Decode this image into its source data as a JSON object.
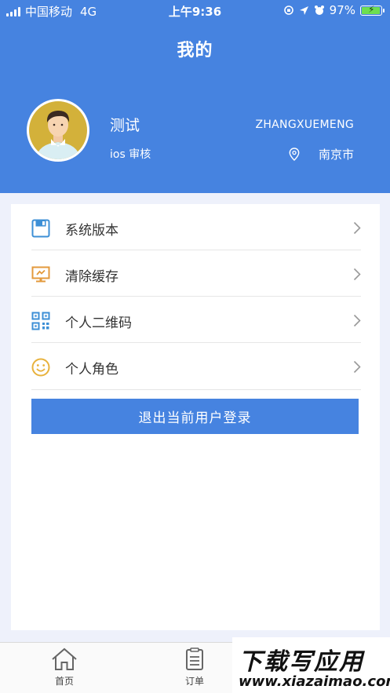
{
  "status_bar": {
    "carrier": "中国移动",
    "network": "4G",
    "time": "上午9:36",
    "battery_percent": "97%",
    "battery_level": 0.97
  },
  "header": {
    "title": "我的",
    "user_name": "测试",
    "user_role": "ios 审核",
    "account": "ZHANGXUEMENG",
    "location": "南京市"
  },
  "menu": {
    "items": [
      {
        "label": "系统版本",
        "icon": "floppy-icon"
      },
      {
        "label": "清除缓存",
        "icon": "monitor-icon"
      },
      {
        "label": "个人二维码",
        "icon": "qrcode-icon"
      },
      {
        "label": "个人角色",
        "icon": "smiley-icon"
      }
    ],
    "logout_label": "退出当前用户登录"
  },
  "tabbar": {
    "tabs": [
      {
        "label": "首页",
        "icon": "home-icon"
      },
      {
        "label": "订单",
        "icon": "clipboard-icon"
      }
    ]
  },
  "watermark": {
    "line1": "下载写应用",
    "line2": "www.xiazaimao.com"
  },
  "colors": {
    "primary": "#4683e0",
    "background": "#eef1fb",
    "icon_blue": "#3d8fd6",
    "icon_orange": "#e39a3c",
    "icon_yellow": "#e8b23c"
  }
}
